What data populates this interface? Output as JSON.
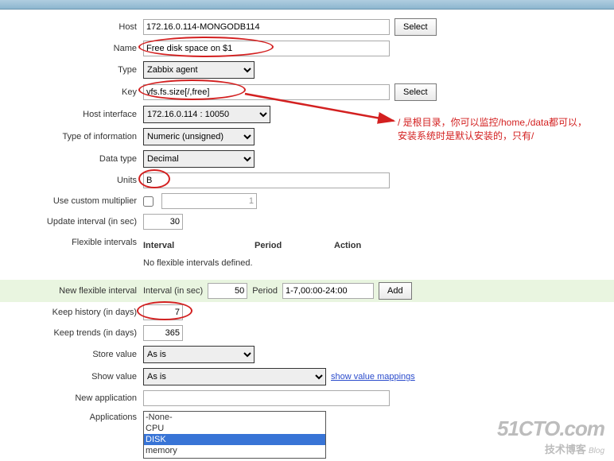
{
  "topbar": {},
  "fields": {
    "host_label": "Host",
    "host_value": "172.16.0.114-MONGODB114",
    "host_select_btn": "Select",
    "name_label": "Name",
    "name_value": "Free disk space on $1",
    "type_label": "Type",
    "type_value": "Zabbix agent",
    "key_label": "Key",
    "key_value": "vfs.fs.size[/,free]",
    "key_select_btn": "Select",
    "hostif_label": "Host interface",
    "hostif_value": "172.16.0.114 : 10050",
    "info_label": "Type of information",
    "info_value": "Numeric (unsigned)",
    "datatype_label": "Data type",
    "datatype_value": "Decimal",
    "units_label": "Units",
    "units_value": "B",
    "mult_label": "Use custom multiplier",
    "mult_value": "1",
    "updint_label": "Update interval (in sec)",
    "updint_value": "30",
    "flexint_label": "Flexible intervals",
    "flex_table": {
      "col_interval": "Interval",
      "col_period": "Period",
      "col_action": "Action",
      "msg": "No flexible intervals defined."
    },
    "newflex_label": "New flexible interval",
    "newflex_int_label": "Interval (in sec)",
    "newflex_int_value": "50",
    "newflex_per_label": "Period",
    "newflex_per_value": "1-7,00:00-24:00",
    "newflex_add_btn": "Add",
    "hist_label": "Keep history (in days)",
    "hist_value": "7",
    "trend_label": "Keep trends (in days)",
    "trend_value": "365",
    "store_label": "Store value",
    "store_value": "As is",
    "show_label": "Show value",
    "show_value": "As is",
    "show_link": "show value mappings",
    "newapp_label": "New application",
    "newapp_value": "",
    "apps_label": "Applications",
    "apps_options": [
      "-None-",
      "CPU",
      "DISK",
      "memory"
    ],
    "apps_selected": "DISK"
  },
  "annot_text": "/ 是根目录，你可以监控/home,/data都可以，安装系统时是默认安装的，只有/",
  "watermark": {
    "big": "51CTO.com",
    "sm": "技术博客",
    "tag": "Blog"
  }
}
